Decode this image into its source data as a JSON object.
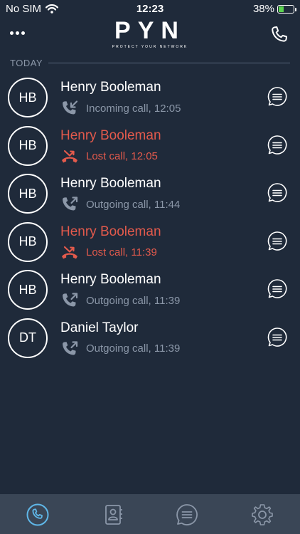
{
  "status_bar": {
    "carrier": "No SIM",
    "time": "12:23",
    "battery": "38%",
    "battery_level": 0.38
  },
  "header": {
    "menu_icon": "more-horizontal-icon",
    "logo_text": "PYN",
    "logo_tagline": "PROTECT YOUR NETWORK",
    "call_icon": "phone-icon"
  },
  "section": {
    "label": "TODAY"
  },
  "calls": [
    {
      "initials": "HB",
      "name": "Henry Booleman",
      "detail": "Incoming call, 12:05",
      "type": "incoming"
    },
    {
      "initials": "HB",
      "name": "Henry Booleman",
      "detail": "Lost call, 12:05",
      "type": "lost"
    },
    {
      "initials": "HB",
      "name": "Henry Booleman",
      "detail": "Outgoing call, 11:44",
      "type": "outgoing"
    },
    {
      "initials": "HB",
      "name": "Henry Booleman",
      "detail": "Lost call, 11:39",
      "type": "lost"
    },
    {
      "initials": "HB",
      "name": "Henry Booleman",
      "detail": "Outgoing call, 11:39",
      "type": "outgoing"
    },
    {
      "initials": "DT",
      "name": "Daniel Taylor",
      "detail": "Outgoing call, 11:39",
      "type": "outgoing"
    }
  ],
  "tabs": [
    {
      "icon": "phone-icon",
      "active": true
    },
    {
      "icon": "contacts-icon",
      "active": false
    },
    {
      "icon": "chat-icon",
      "active": false
    },
    {
      "icon": "settings-icon",
      "active": false
    }
  ],
  "colors": {
    "background": "#1f2a3a",
    "lost": "#e35a4c",
    "muted": "#8b97a8",
    "tab_active": "#5fb7e8",
    "tab_inactive": "#8b97a8"
  }
}
